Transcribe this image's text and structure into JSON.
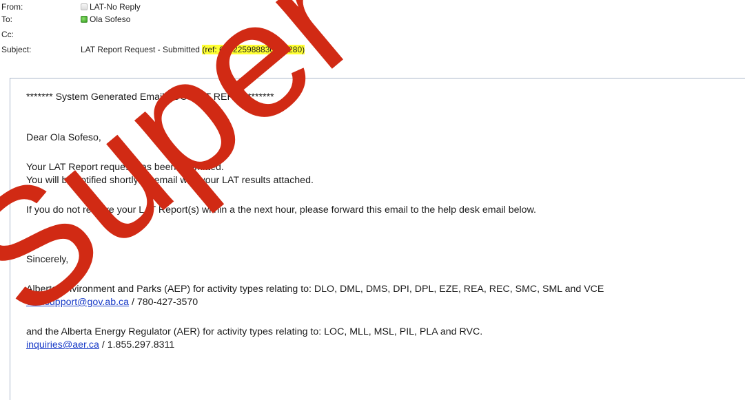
{
  "header": {
    "from_label": "From:",
    "from_value": "LAT-No Reply",
    "to_label": "To:",
    "to_value": "Ola Sofeso",
    "cc_label": "Cc:",
    "subject_label": "Subject:",
    "subject_text": "LAT Report Request - Submitted",
    "subject_ref": "(ref: 636225988830882280)"
  },
  "body": {
    "banner": "******* System Generated Email - DO NOT REPLY *******",
    "greeting": "Dear Ola Sofeso,",
    "line1": "Your LAT Report request has been submitted.",
    "line2": "You will be notified shortly by email with your LAT results attached.",
    "line3": "If you do not receive your LAT Report(s) within a the next hour, please forward this email to the help desk email below.",
    "sincerely": "Sincerely,",
    "aep_line": "Alberta Environment and Parks (AEP) for activity types relating to: DLO, DML, DMS, DPI, DPL, EZE, REA, REC, SMC, SML and VCE",
    "aep_email": "eds.support@gov.ab.ca",
    "aep_phone": " / 780-427-3570",
    "aer_line": "and the Alberta Energy Regulator (AER) for activity types relating to: LOC, MLL, MSL, PIL, PLA and RVC.",
    "aer_email": "inquiries@aer.ca",
    "aer_phone": " / 1.855.297.8311"
  },
  "colors": {
    "highlight": "#ffff33",
    "link": "#1a3cc8",
    "watermark": "#d12a14"
  },
  "icons": {
    "from_presence": "presence-unknown-icon",
    "to_presence": "presence-online-icon"
  },
  "watermark": {
    "text": "Super"
  }
}
